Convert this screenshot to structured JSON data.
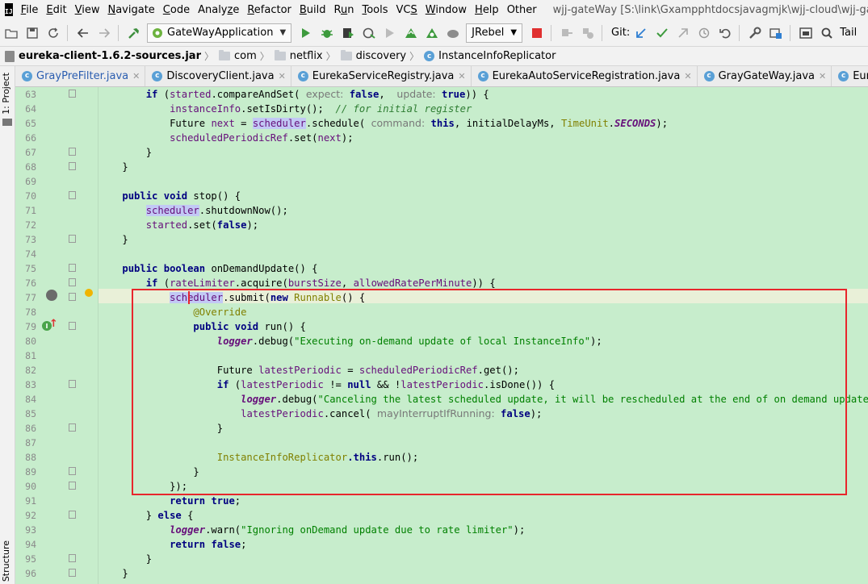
{
  "menubar": {
    "logo": "IJ",
    "items": [
      {
        "pre": "",
        "u": "F",
        "post": "ile"
      },
      {
        "pre": "",
        "u": "E",
        "post": "dit"
      },
      {
        "pre": "",
        "u": "V",
        "post": "iew"
      },
      {
        "pre": "",
        "u": "N",
        "post": "avigate"
      },
      {
        "pre": "",
        "u": "C",
        "post": "ode"
      },
      {
        "pre": "Analy",
        "u": "z",
        "post": "e"
      },
      {
        "pre": "",
        "u": "R",
        "post": "efactor"
      },
      {
        "pre": "",
        "u": "B",
        "post": "uild"
      },
      {
        "pre": "R",
        "u": "u",
        "post": "n"
      },
      {
        "pre": "",
        "u": "T",
        "post": "ools"
      },
      {
        "pre": "VC",
        "u": "S",
        "post": ""
      },
      {
        "pre": "",
        "u": "W",
        "post": "indow"
      },
      {
        "pre": "",
        "u": "H",
        "post": "elp"
      },
      {
        "pre": "Other",
        "u": "",
        "post": ""
      }
    ],
    "window_title": "wjj-gateWay [S:\\link\\Gxampphtdocsjavagmjk\\wjj-cloud\\wjj-gateWay] - ..."
  },
  "toolbar": {
    "run_config": "GateWayApplication",
    "jrebel": "JRebel",
    "git": "Git:",
    "tail": "Tail"
  },
  "breadcrumb": {
    "jar": "eureka-client-1.6.2-sources.jar",
    "p1": "com",
    "p2": "netflix",
    "p3": "discovery",
    "cls": "InstanceInfoReplicator"
  },
  "left_strip": {
    "project": "1: Project",
    "structure": "Structure"
  },
  "tabs": [
    "GrayPreFilter.java",
    "DiscoveryClient.java",
    "EurekaServiceRegistry.java",
    "EurekaAutoServiceRegistration.java",
    "GrayGateWay.java",
    "EurekaDiscoveryCli"
  ],
  "line_numbers": [
    "63",
    "64",
    "65",
    "66",
    "67",
    "68",
    "69",
    "70",
    "71",
    "72",
    "73",
    "74",
    "75",
    "76",
    "77",
    "78",
    "79",
    "80",
    "81",
    "82",
    "83",
    "84",
    "85",
    "86",
    "87",
    "88",
    "89",
    "90",
    "91",
    "92",
    "93",
    "94",
    "95",
    "96"
  ],
  "code": {
    "l63": {
      "if": "if",
      "started": "started",
      "cas": ".compareAndSet(",
      "p_expect": "expect:",
      "false1": "false",
      "p_update": "update:",
      "true1": "true",
      "end": "))",
      "brace": " {"
    },
    "l64": {
      "instanceInfo": "instanceInfo",
      "dirty": ".setIsDirty();",
      "comment": "// for initial register"
    },
    "l65": {
      "future": "Future ",
      "next": "next",
      "eq": " = ",
      "scheduler": "scheduler",
      "schedule": ".schedule(",
      "p_command": "command:",
      "this": "this",
      "rest": ", initialDelayMs, ",
      "timeunit": "TimeUnit",
      "dot": ".",
      "seconds": "SECONDS",
      "end": ");"
    },
    "l66": {
      "ref": "scheduledPeriodicRef",
      "set": ".set(",
      "next": "next",
      "end": ");"
    },
    "l67": "}",
    "l68": "}",
    "l70": {
      "public": "public ",
      "void": "void ",
      "name": "stop",
      "rest": "() {"
    },
    "l71": {
      "scheduler": "scheduler",
      "rest": ".shutdownNow();"
    },
    "l72": {
      "started": "started",
      "set": ".set(",
      "false": "false",
      "end": ");"
    },
    "l73": "}",
    "l75": {
      "public": "public ",
      "boolean": "boolean ",
      "name": "onDemandUpdate",
      "rest": "() {"
    },
    "l76": {
      "if": "if",
      "open": " (",
      "rl": "rateLimiter",
      "acq": ".acquire(",
      "burst": "burstSize",
      "comma": ", ",
      "allowed": "allowedRatePerMinute",
      "end": ")) {"
    },
    "l77": {
      "sched_a": "sched",
      "sched_b": "uler",
      "submit": ".submit(",
      "new": "new ",
      "runnable": "Runnable",
      "end": "() {"
    },
    "l78": "@Override",
    "l79": {
      "public": "public ",
      "void": "void ",
      "name": "run",
      "rest": "() {"
    },
    "l80": {
      "logger": "logger",
      "debug": ".debug(",
      "str": "\"Executing on-demand update of local InstanceInfo\"",
      "end": ");"
    },
    "l82": {
      "future": "Future ",
      "latest": "latestPeriodic",
      "eq": " = ",
      "ref": "scheduledPeriodicRef",
      "get": ".get();"
    },
    "l83": {
      "if": "if",
      "open": " (",
      "latest1": "latestPeriodic",
      "neq": " != ",
      "null": "null",
      "and": " && !",
      "latest2": "latestPeriodic",
      "isdone": ".isDone()) {"
    },
    "l84": {
      "logger": "logger",
      "debug": ".debug(",
      "str": "\"Canceling the latest scheduled update, it will be rescheduled at the end of on demand update\"",
      "end": ");"
    },
    "l85": {
      "latest": "latestPeriodic",
      "cancel": ".cancel(",
      "p_may": "mayInterruptIfRunning:",
      "false": "false",
      "end": ");"
    },
    "l86": "}",
    "l88": {
      "cls": "InstanceInfoReplicator",
      "this": ".this",
      "run": ".run();"
    },
    "l89": "}",
    "l90": "});",
    "l91": {
      "return": "return ",
      "true": "true",
      "end": ";"
    },
    "l92": {
      "close": "} ",
      "else": "else",
      "rest": " {"
    },
    "l93": {
      "logger": "logger",
      "warn": ".warn(",
      "str": "\"Ignoring onDemand update due to rate limiter\"",
      "end": ");"
    },
    "l94": {
      "return": "return ",
      "false": "false",
      "end": ";"
    },
    "l95": "}",
    "l96": "}"
  }
}
